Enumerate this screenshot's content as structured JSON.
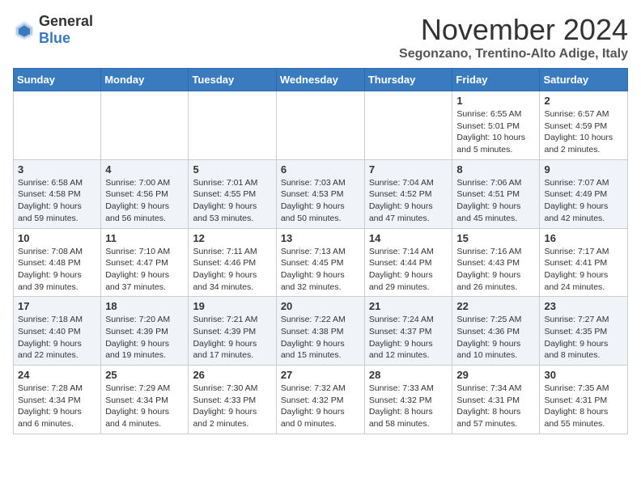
{
  "logo": {
    "text_general": "General",
    "text_blue": "Blue"
  },
  "title": "November 2024",
  "location": "Segonzano, Trentino-Alto Adige, Italy",
  "weekdays": [
    "Sunday",
    "Monday",
    "Tuesday",
    "Wednesday",
    "Thursday",
    "Friday",
    "Saturday"
  ],
  "weeks": [
    [
      {
        "day": "",
        "info": ""
      },
      {
        "day": "",
        "info": ""
      },
      {
        "day": "",
        "info": ""
      },
      {
        "day": "",
        "info": ""
      },
      {
        "day": "",
        "info": ""
      },
      {
        "day": "1",
        "info": "Sunrise: 6:55 AM\nSunset: 5:01 PM\nDaylight: 10 hours and 5 minutes."
      },
      {
        "day": "2",
        "info": "Sunrise: 6:57 AM\nSunset: 4:59 PM\nDaylight: 10 hours and 2 minutes."
      }
    ],
    [
      {
        "day": "3",
        "info": "Sunrise: 6:58 AM\nSunset: 4:58 PM\nDaylight: 9 hours and 59 minutes."
      },
      {
        "day": "4",
        "info": "Sunrise: 7:00 AM\nSunset: 4:56 PM\nDaylight: 9 hours and 56 minutes."
      },
      {
        "day": "5",
        "info": "Sunrise: 7:01 AM\nSunset: 4:55 PM\nDaylight: 9 hours and 53 minutes."
      },
      {
        "day": "6",
        "info": "Sunrise: 7:03 AM\nSunset: 4:53 PM\nDaylight: 9 hours and 50 minutes."
      },
      {
        "day": "7",
        "info": "Sunrise: 7:04 AM\nSunset: 4:52 PM\nDaylight: 9 hours and 47 minutes."
      },
      {
        "day": "8",
        "info": "Sunrise: 7:06 AM\nSunset: 4:51 PM\nDaylight: 9 hours and 45 minutes."
      },
      {
        "day": "9",
        "info": "Sunrise: 7:07 AM\nSunset: 4:49 PM\nDaylight: 9 hours and 42 minutes."
      }
    ],
    [
      {
        "day": "10",
        "info": "Sunrise: 7:08 AM\nSunset: 4:48 PM\nDaylight: 9 hours and 39 minutes."
      },
      {
        "day": "11",
        "info": "Sunrise: 7:10 AM\nSunset: 4:47 PM\nDaylight: 9 hours and 37 minutes."
      },
      {
        "day": "12",
        "info": "Sunrise: 7:11 AM\nSunset: 4:46 PM\nDaylight: 9 hours and 34 minutes."
      },
      {
        "day": "13",
        "info": "Sunrise: 7:13 AM\nSunset: 4:45 PM\nDaylight: 9 hours and 32 minutes."
      },
      {
        "day": "14",
        "info": "Sunrise: 7:14 AM\nSunset: 4:44 PM\nDaylight: 9 hours and 29 minutes."
      },
      {
        "day": "15",
        "info": "Sunrise: 7:16 AM\nSunset: 4:43 PM\nDaylight: 9 hours and 26 minutes."
      },
      {
        "day": "16",
        "info": "Sunrise: 7:17 AM\nSunset: 4:41 PM\nDaylight: 9 hours and 24 minutes."
      }
    ],
    [
      {
        "day": "17",
        "info": "Sunrise: 7:18 AM\nSunset: 4:40 PM\nDaylight: 9 hours and 22 minutes."
      },
      {
        "day": "18",
        "info": "Sunrise: 7:20 AM\nSunset: 4:39 PM\nDaylight: 9 hours and 19 minutes."
      },
      {
        "day": "19",
        "info": "Sunrise: 7:21 AM\nSunset: 4:39 PM\nDaylight: 9 hours and 17 minutes."
      },
      {
        "day": "20",
        "info": "Sunrise: 7:22 AM\nSunset: 4:38 PM\nDaylight: 9 hours and 15 minutes."
      },
      {
        "day": "21",
        "info": "Sunrise: 7:24 AM\nSunset: 4:37 PM\nDaylight: 9 hours and 12 minutes."
      },
      {
        "day": "22",
        "info": "Sunrise: 7:25 AM\nSunset: 4:36 PM\nDaylight: 9 hours and 10 minutes."
      },
      {
        "day": "23",
        "info": "Sunrise: 7:27 AM\nSunset: 4:35 PM\nDaylight: 9 hours and 8 minutes."
      }
    ],
    [
      {
        "day": "24",
        "info": "Sunrise: 7:28 AM\nSunset: 4:34 PM\nDaylight: 9 hours and 6 minutes."
      },
      {
        "day": "25",
        "info": "Sunrise: 7:29 AM\nSunset: 4:34 PM\nDaylight: 9 hours and 4 minutes."
      },
      {
        "day": "26",
        "info": "Sunrise: 7:30 AM\nSunset: 4:33 PM\nDaylight: 9 hours and 2 minutes."
      },
      {
        "day": "27",
        "info": "Sunrise: 7:32 AM\nSunset: 4:32 PM\nDaylight: 9 hours and 0 minutes."
      },
      {
        "day": "28",
        "info": "Sunrise: 7:33 AM\nSunset: 4:32 PM\nDaylight: 8 hours and 58 minutes."
      },
      {
        "day": "29",
        "info": "Sunrise: 7:34 AM\nSunset: 4:31 PM\nDaylight: 8 hours and 57 minutes."
      },
      {
        "day": "30",
        "info": "Sunrise: 7:35 AM\nSunset: 4:31 PM\nDaylight: 8 hours and 55 minutes."
      }
    ]
  ]
}
